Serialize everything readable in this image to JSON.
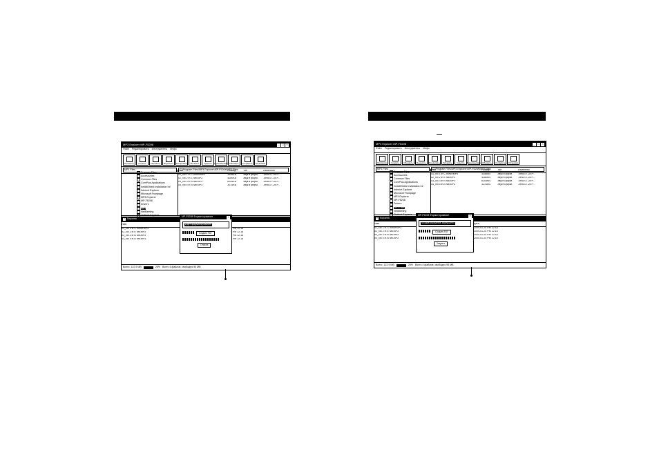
{
  "left": {
    "window_title": "MP3 Explorer MP-F5208",
    "menu": [
      "Файл",
      "Редактировать",
      "Инструменты",
      "Инфо"
    ],
    "toolbar": [
      "Просмотр",
      "Создать",
      "Обновить",
      "Выделить",
      "Копировать",
      "Вставить",
      "Удалить",
      "Переименовать",
      "Обновить",
      "Отправить",
      "Установки"
    ],
    "drive_combo": "MP3 Files",
    "path_combo": "C:\\Program Files\\MP3 Explorer\\MP-F5208\\MP3 Files",
    "tree": [
      "Program Files",
      "Accessories",
      "Common Files",
      "ComPlus Applications",
      "InstallShield Installation Inf",
      "Internet Explorer",
      "Microsoft Frontpage",
      "MP3 Explorer",
      "MP-F5208",
      "Drivers",
      "MP3",
      "NetMeeting",
      "Outlook Express"
    ],
    "columns": [
      "Имя",
      "Размер",
      "Тип",
      "Изменено"
    ],
    "files": [
      {
        "name": "01_No 1 in C minor.MP3",
        "size": "3356KB",
        "type": "Звук в форм.",
        "date": "1998-07-28 P..."
      },
      {
        "name": "02_No 2 in E flat.MP3",
        "size": "4280KB",
        "type": "Звук в форм.",
        "date": "1998-07-28 P..."
      },
      {
        "name": "03_No 3 in B flat.MP3",
        "size": "6205KB",
        "type": "Звук в форм.",
        "date": "1998-07-28 P..."
      },
      {
        "name": "04_No 4 in B flat.MP3",
        "size": "3214KB",
        "type": "Звук в форм.",
        "date": "1998-07-28 P..."
      }
    ],
    "dialog_title": "MP-F5208 Форматирование",
    "dialog_message": "Идет форматирование",
    "dialog_button1": "Создать FAT",
    "dialog_button2": "Отмена",
    "lower_title": "Корзина",
    "lower_columns": [
      "Имя",
      "Размер",
      "Дата"
    ],
    "lower_files": [
      {
        "name": "01_No 1 in C minor.MP3",
        "size": "3356KB",
        "date": "2004-01-20 PM 12:18"
      },
      {
        "name": "02_No 2 in E flat.MP3",
        "size": "4280KB",
        "date": "2004-01-20 PM 12:18"
      },
      {
        "name": "03_No 3 in B flat.MP3",
        "size": "6205KB",
        "date": "2004-01-20 PM 12:18"
      },
      {
        "name": "04_No 4 in B flat.MP3",
        "size": "3214KB",
        "date": "2004-01-20 PM 12:18"
      }
    ],
    "status": [
      "Всего: 122.9 MB",
      "25%",
      "Всего 4 файлов, свободно 95 MB"
    ]
  },
  "right": {
    "window_title": "MP3 Explorer MP-F5208",
    "menu": [
      "Файл",
      "Редактировать",
      "Инструменты",
      "Инфо"
    ],
    "toolbar": [
      "Просмотр",
      "Создать",
      "Обновить",
      "Выделить",
      "Копировать",
      "Вставить",
      "Удалить",
      "Переименовать",
      "Обновить",
      "Отправить",
      "Установки"
    ],
    "drive_combo": "MP3 Files",
    "path_combo": "C:\\Program Files\\MP3 Explorer\\MP-F5208\\MP3 Files",
    "tree": [
      "Program Files",
      "Accessories",
      "Common Files",
      "ComPlus Applications",
      "InstallShield Installation Inf",
      "Internet Explorer",
      "Microsoft Frontpage",
      "MP3 Explorer",
      "MP-F5208",
      "Drivers",
      "MP3 Files",
      "NetMeeting",
      "Outlook Express"
    ],
    "columns": [
      "Имя",
      "Размер",
      "Тип",
      "Изменено"
    ],
    "files": [
      {
        "name": "01_No 1 in C minor.MP3",
        "size": "3356KB",
        "type": "Звук в форм.",
        "date": "1998-07-28 P..."
      },
      {
        "name": "02_No 2 in E flat.MP3",
        "size": "4280KB",
        "type": "Звук в форм.",
        "date": "1998-07-28 P..."
      },
      {
        "name": "03_No 3 in B flat.MP3",
        "size": "6205KB",
        "type": "Звук в форм.",
        "date": "1998-07-28 P..."
      },
      {
        "name": "04_No 4 in B flat.MP3",
        "size": "3214KB",
        "type": "Звук в форм.",
        "date": "1998-07-28 P..."
      }
    ],
    "dialog_title": "MP-F5208 Форматирование",
    "dialog_message": "Форматирование завершено",
    "dialog_button1": "Создать FAT",
    "dialog_button2": "Закрыть",
    "lower_title": "Корзина",
    "lower_columns": [
      "Имя",
      "Размер",
      "Дата"
    ],
    "lower_files": [
      {
        "name": "01_No 1 in C minor.MP3",
        "size": "3356KB",
        "date": "2004-01-20 PM 12:18"
      },
      {
        "name": "02_No 2 in E flat.MP3",
        "size": "4280KB",
        "date": "2004-01-20 PM 12:18"
      },
      {
        "name": "03_No 3 in B flat.MP3",
        "size": "6205KB",
        "date": "2004-01-20 PM 12:18"
      },
      {
        "name": "04_No 4 in B flat.MP3",
        "size": "3214KB",
        "date": "2004-01-20 PM 12:18"
      }
    ],
    "status": [
      "Всего: 122.9 MB",
      "25%",
      "Всего 4 файлов, свободно 95 MB"
    ]
  }
}
